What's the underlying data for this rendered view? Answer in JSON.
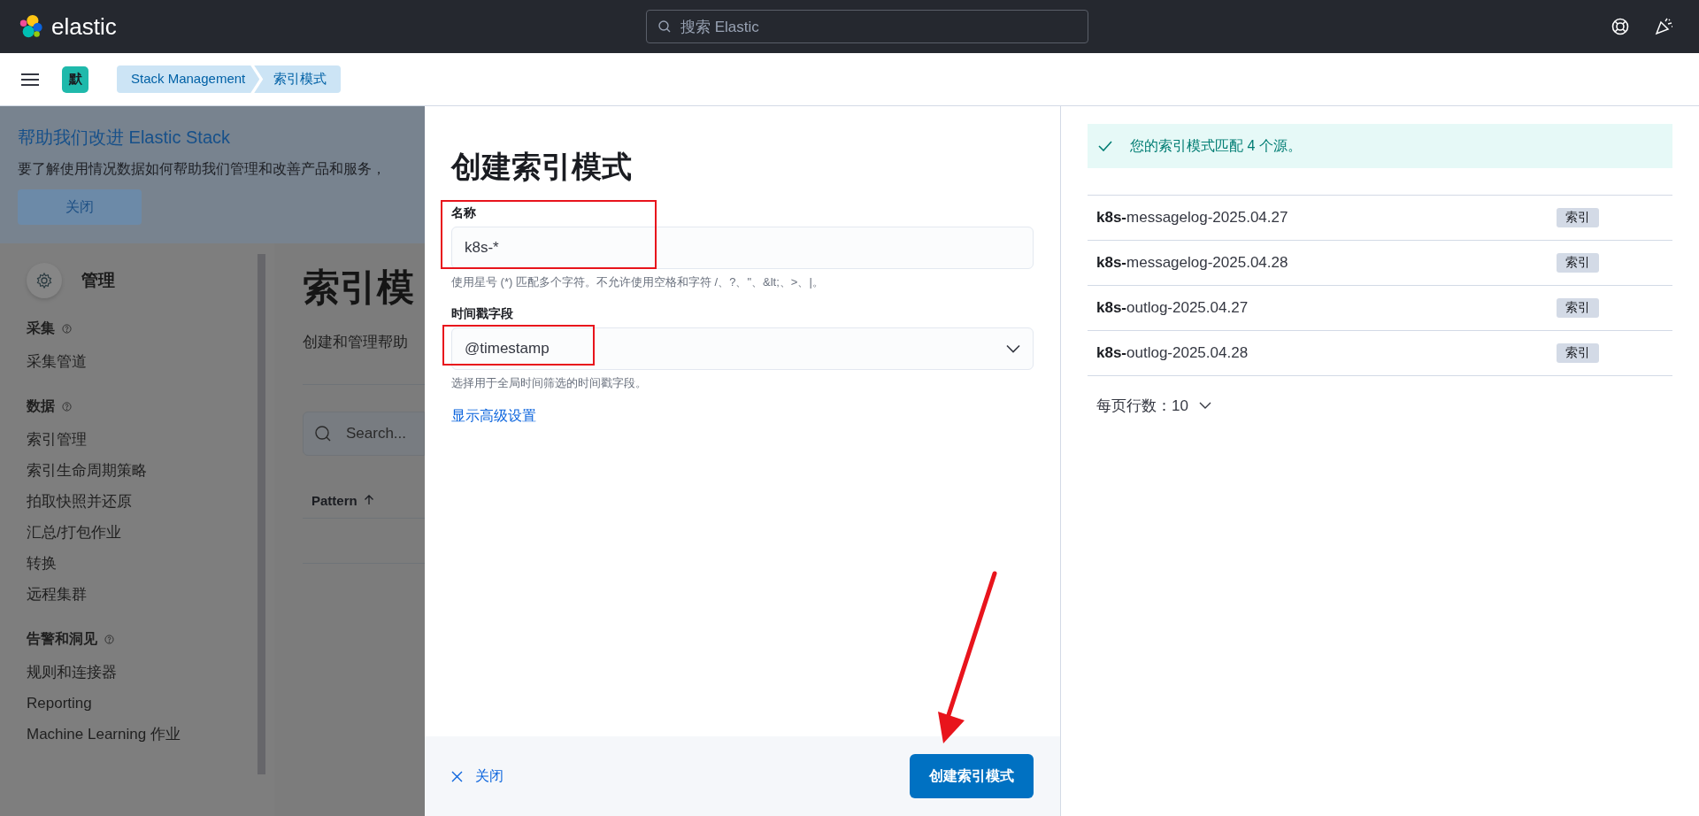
{
  "header": {
    "logo_text": "elastic",
    "search": {
      "placeholder": "搜索 Elastic"
    }
  },
  "breadcrumbs": {
    "space_badge": "默",
    "items": [
      {
        "label": "Stack Management"
      },
      {
        "label": "索引模式"
      }
    ]
  },
  "banner": {
    "title": "帮助我们改进 Elastic Stack",
    "text": "要了解使用情况数据如何帮助我们管理和改善产品和服务，",
    "button": "关闭"
  },
  "sidebar": {
    "title": "管理",
    "sections": [
      {
        "title": "采集",
        "items": [
          "采集管道"
        ]
      },
      {
        "title": "数据",
        "items": [
          "索引管理",
          "索引生命周期策略",
          "拍取快照并还原",
          "汇总/打包作业",
          "转换",
          "远程集群"
        ]
      },
      {
        "title": "告警和洞见",
        "items": [
          "规则和连接器",
          "Reporting",
          "Machine Learning 作业"
        ]
      }
    ]
  },
  "page": {
    "title": "索引模",
    "description": "创建和管理帮助",
    "search": {
      "placeholder": "Search..."
    },
    "table": {
      "columns": [
        {
          "label": "Pattern",
          "sorted": true
        }
      ]
    }
  },
  "flyout": {
    "title": "创建索引模式",
    "fields": [
      {
        "kind": "text",
        "label": "名称",
        "value": "k8s-*",
        "help": "使用星号 (*) 匹配多个字符。不允许使用空格和字符 /、?、\"、&lt;、>、|。",
        "highlighted": true
      },
      {
        "kind": "select",
        "label": "时间戳字段",
        "value": "@timestamp",
        "help": "选择用于全局时间筛选的时间戳字段。",
        "highlighted": true
      }
    ],
    "advanced_link": "显示高级设置",
    "close_button": "关闭",
    "submit_button": "创建索引模式"
  },
  "results": {
    "callout": "您的索引模式匹配 4 个源。",
    "rows": [
      {
        "name": "**k8s-**messagelog-2025.04.27",
        "badge": "索引"
      },
      {
        "name": "**k8s-**messagelog-2025.04.28",
        "badge": "索引"
      },
      {
        "name": "**k8s-**outlog-2025.04.27",
        "badge": "索引"
      },
      {
        "name": "**k8s-**outlog-2025.04.28",
        "badge": "索引"
      }
    ],
    "rows_per_page": "每页行数：10"
  }
}
